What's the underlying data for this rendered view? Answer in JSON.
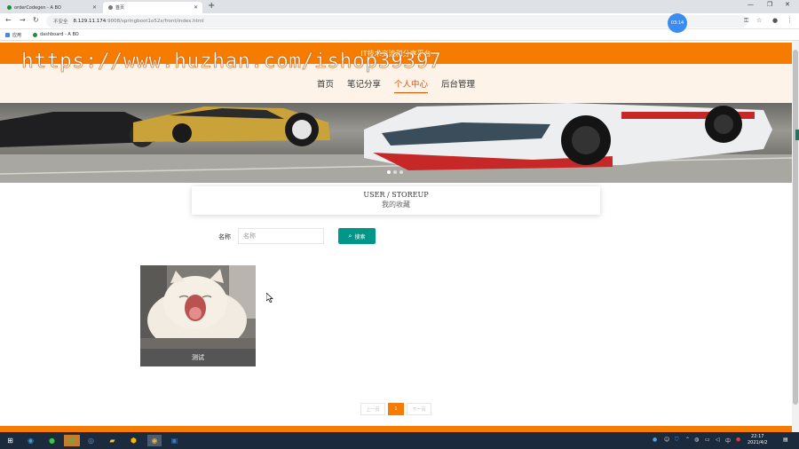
{
  "browser": {
    "tabs": [
      {
        "title": "orderCodegen - A BO",
        "color": "#1e8e3e",
        "active": false
      },
      {
        "title": "首页",
        "color": "#555555",
        "active": true
      }
    ],
    "new_tab": "+",
    "address": {
      "security": "不安全",
      "host": "8.129.11.174",
      "path": ":9008/springboot1o52x/front/index.html"
    },
    "recording_badge": "03:14",
    "bookmarks": [
      {
        "label": "应用",
        "color": "#4285f4"
      },
      {
        "label": "dashboard - A BO",
        "color": "#1e8e3e"
      }
    ]
  },
  "site": {
    "title": "IT技术交流和分享平台",
    "nav": [
      {
        "label": "首页",
        "active": false
      },
      {
        "label": "笔记分享",
        "active": false
      },
      {
        "label": "个人中心",
        "active": true
      },
      {
        "label": "后台管理",
        "active": false
      }
    ],
    "banner_dots": 3
  },
  "section": {
    "title_en": "USER / STOREUP",
    "title_cn": "我的收藏"
  },
  "search": {
    "label": "名称",
    "placeholder": "名称",
    "button": "搜索"
  },
  "favorites": [
    {
      "caption": "测试"
    }
  ],
  "pagination": {
    "prev": "上一页",
    "current": "1",
    "next": "下一页"
  },
  "watermark": "https://www.huzhan.com/ishop39397",
  "taskbar": {
    "time": "22:17",
    "date": "2021/4/2"
  },
  "colors": {
    "brand": "#f57c00",
    "search_button": "#009688",
    "nav_active": "#e65100"
  }
}
